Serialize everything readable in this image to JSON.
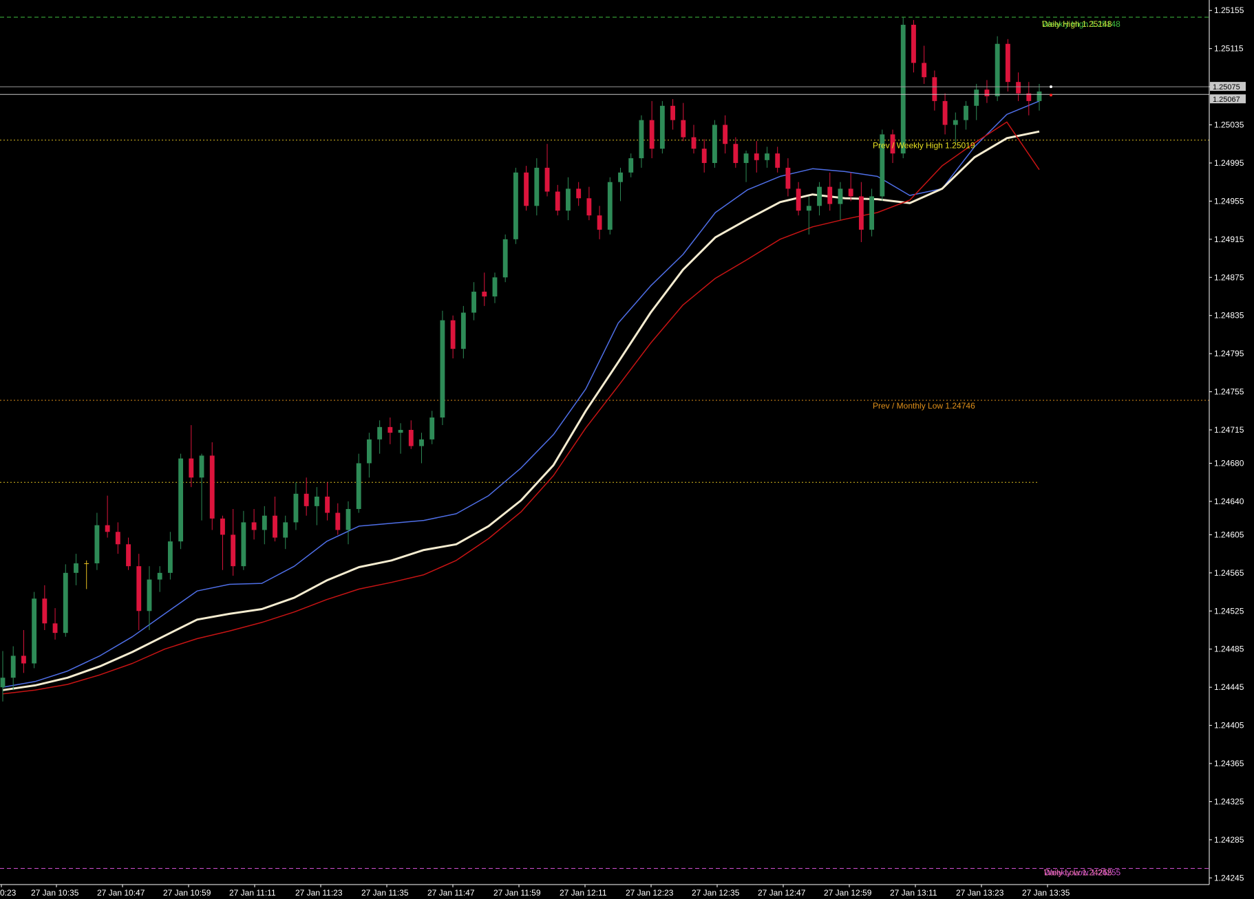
{
  "chart_data": {
    "type": "candlestick",
    "symbol_pair_note": "",
    "y_axis": {
      "ticks": [
        "1.25155",
        "1.25115",
        "1.25075",
        "1.25035",
        "1.24995",
        "1.24955",
        "1.24915",
        "1.24875",
        "1.24835",
        "1.24795",
        "1.24755",
        "1.24715",
        "1.24680",
        "1.24640",
        "1.24605",
        "1.24565",
        "1.24525",
        "1.24485",
        "1.24445",
        "1.24405",
        "1.24365",
        "1.24325",
        "1.24285",
        "1.24245"
      ],
      "ylim": [
        1.24238,
        1.25166
      ]
    },
    "x_axis": {
      "ticks": [
        "0:23",
        "27 Jan 10:35",
        "27 Jan 10:47",
        "27 Jan 10:59",
        "27 Jan 11:11",
        "27 Jan 11:23",
        "27 Jan 11:35",
        "27 Jan 11:47",
        "27 Jan 11:59",
        "27 Jan 12:11",
        "27 Jan 12:23",
        "27 Jan 12:35",
        "27 Jan 12:47",
        "27 Jan 12:59",
        "27 Jan 13:11",
        "27 Jan 13:23",
        "27 Jan 13:35"
      ]
    },
    "current_price": {
      "bid": "1.25067",
      "ask": "1.25075",
      "bid_value": 1.25067,
      "ask_value": 1.25075
    },
    "levels": [
      {
        "label": "Weekly High 1.25148",
        "value": 1.25148,
        "color": "#3fbf3f",
        "style": "dashed",
        "label_color": "#3fbf3f"
      },
      {
        "label": "Daily High 1.25148",
        "value": 1.25148,
        "color": "#3fbf3f",
        "style": "none",
        "label_color": "#c8e03a"
      },
      {
        "label": "Prev / Weekly High 1.25019",
        "value": 1.25019,
        "color": "#e0c020",
        "style": "dotted",
        "label_color": "#e8e020"
      },
      {
        "label": "Prev / Monthly Low 1.24746",
        "value": 1.24746,
        "color": "#e0901a",
        "style": "dotted",
        "label_color": "#e0901a"
      },
      {
        "label": "",
        "value": 1.2466,
        "color": "#e0c020",
        "style": "dotted",
        "label_color": "#e0c020"
      },
      {
        "label": "Weekly Low 1.24255",
        "value": 1.24255,
        "color": "#d050d0",
        "style": "dashed",
        "label_color": "#d050d0"
      },
      {
        "label": "Daily Low 1.24255",
        "value": 1.24255,
        "color": "#d050d0",
        "style": "none",
        "label_color": "#f070b0"
      }
    ],
    "moving_averages": [
      {
        "color": "#4f6fe8",
        "width": 1.5,
        "values": [
          1.24445,
          1.24451,
          1.24462,
          1.24478,
          1.24498,
          1.24522,
          1.24546,
          1.24553,
          1.24554,
          1.24572,
          1.24598,
          1.24614,
          1.24617,
          1.2462,
          1.24627,
          1.24646,
          1.24675,
          1.2471,
          1.24758,
          1.24827,
          1.24866,
          1.24899,
          1.24943,
          1.24967,
          1.24981,
          1.24989,
          1.24986,
          1.24981,
          1.24961,
          1.24968,
          1.25012,
          1.25046,
          1.2506
        ]
      },
      {
        "color": "#f5ecd0",
        "width": 3,
        "values": [
          1.24442,
          1.24447,
          1.24455,
          1.24467,
          1.24482,
          1.24499,
          1.24516,
          1.24522,
          1.24527,
          1.24539,
          1.24557,
          1.24571,
          1.24578,
          1.24589,
          1.24595,
          1.24614,
          1.24641,
          1.24678,
          1.24735,
          1.24786,
          1.24838,
          1.24883,
          1.24917,
          1.24936,
          1.24954,
          1.24962,
          1.24958,
          1.24957,
          1.24953,
          1.24968,
          1.25001,
          1.25021,
          1.25028
        ]
      },
      {
        "color": "#c81414",
        "width": 1.5,
        "values": [
          1.24438,
          1.24442,
          1.24448,
          1.24458,
          1.2447,
          1.24485,
          1.24496,
          1.24504,
          1.24513,
          1.24524,
          1.24537,
          1.24548,
          1.24555,
          1.24563,
          1.24578,
          1.24601,
          1.24629,
          1.24667,
          1.24717,
          1.24761,
          1.24806,
          1.24846,
          1.24874,
          1.24894,
          1.24915,
          1.24928,
          1.24936,
          1.24943,
          1.24956,
          1.24992,
          1.25016,
          1.25038,
          1.24988
        ]
      }
    ],
    "candle_colors": {
      "bull": "#2e8b57",
      "bear": "#dc143c",
      "doji": "#e8c020"
    },
    "candles": [
      {
        "o": 1.24445,
        "h": 1.24483,
        "l": 1.2443,
        "c": 1.24455
      },
      {
        "o": 1.24455,
        "h": 1.24488,
        "l": 1.24442,
        "c": 1.24478
      },
      {
        "o": 1.24478,
        "h": 1.24505,
        "l": 1.2446,
        "c": 1.2447
      },
      {
        "o": 1.2447,
        "h": 1.24545,
        "l": 1.24465,
        "c": 1.24538
      },
      {
        "o": 1.24538,
        "h": 1.24552,
        "l": 1.24505,
        "c": 1.24512
      },
      {
        "o": 1.24512,
        "h": 1.24528,
        "l": 1.24495,
        "c": 1.24502
      },
      {
        "o": 1.24502,
        "h": 1.24574,
        "l": 1.24498,
        "c": 1.24565
      },
      {
        "o": 1.24565,
        "h": 1.24585,
        "l": 1.24552,
        "c": 1.24575
      },
      {
        "o": 1.24575,
        "h": 1.24578,
        "l": 1.24548,
        "c": 1.24575
      },
      {
        "o": 1.24575,
        "h": 1.24628,
        "l": 1.24568,
        "c": 1.24615
      },
      {
        "o": 1.24615,
        "h": 1.24646,
        "l": 1.24602,
        "c": 1.24608
      },
      {
        "o": 1.24608,
        "h": 1.24618,
        "l": 1.24585,
        "c": 1.24595
      },
      {
        "o": 1.24595,
        "h": 1.24602,
        "l": 1.24568,
        "c": 1.24572
      },
      {
        "o": 1.24572,
        "h": 1.24585,
        "l": 1.24505,
        "c": 1.24525
      },
      {
        "o": 1.24525,
        "h": 1.24572,
        "l": 1.24505,
        "c": 1.24558
      },
      {
        "o": 1.24558,
        "h": 1.24572,
        "l": 1.24545,
        "c": 1.24565
      },
      {
        "o": 1.24565,
        "h": 1.24608,
        "l": 1.24558,
        "c": 1.24598
      },
      {
        "o": 1.24598,
        "h": 1.2469,
        "l": 1.2459,
        "c": 1.24685
      },
      {
        "o": 1.24685,
        "h": 1.2472,
        "l": 1.24655,
        "c": 1.24665
      },
      {
        "o": 1.24665,
        "h": 1.2469,
        "l": 1.2462,
        "c": 1.24688
      },
      {
        "o": 1.24688,
        "h": 1.24702,
        "l": 1.2461,
        "c": 1.24622
      },
      {
        "o": 1.24622,
        "h": 1.24625,
        "l": 1.24568,
        "c": 1.24605
      },
      {
        "o": 1.24605,
        "h": 1.24632,
        "l": 1.24562,
        "c": 1.24572
      },
      {
        "o": 1.24572,
        "h": 1.2463,
        "l": 1.24568,
        "c": 1.24618
      },
      {
        "o": 1.24618,
        "h": 1.24632,
        "l": 1.246,
        "c": 1.2461
      },
      {
        "o": 1.2461,
        "h": 1.24635,
        "l": 1.24595,
        "c": 1.24625
      },
      {
        "o": 1.24625,
        "h": 1.24645,
        "l": 1.24598,
        "c": 1.24602
      },
      {
        "o": 1.24602,
        "h": 1.24625,
        "l": 1.2459,
        "c": 1.24618
      },
      {
        "o": 1.24618,
        "h": 1.2466,
        "l": 1.2461,
        "c": 1.24648
      },
      {
        "o": 1.24648,
        "h": 1.24665,
        "l": 1.24625,
        "c": 1.24635
      },
      {
        "o": 1.24635,
        "h": 1.24655,
        "l": 1.24615,
        "c": 1.24645
      },
      {
        "o": 1.24645,
        "h": 1.2466,
        "l": 1.2462,
        "c": 1.24628
      },
      {
        "o": 1.24628,
        "h": 1.24638,
        "l": 1.24605,
        "c": 1.2461
      },
      {
        "o": 1.2461,
        "h": 1.2464,
        "l": 1.24595,
        "c": 1.24632
      },
      {
        "o": 1.24632,
        "h": 1.2469,
        "l": 1.24628,
        "c": 1.2468
      },
      {
        "o": 1.2468,
        "h": 1.24712,
        "l": 1.24665,
        "c": 1.24705
      },
      {
        "o": 1.24705,
        "h": 1.24725,
        "l": 1.2469,
        "c": 1.24718
      },
      {
        "o": 1.24718,
        "h": 1.24728,
        "l": 1.247,
        "c": 1.24712
      },
      {
        "o": 1.24712,
        "h": 1.24722,
        "l": 1.2469,
        "c": 1.24715
      },
      {
        "o": 1.24715,
        "h": 1.24725,
        "l": 1.24695,
        "c": 1.24698
      },
      {
        "o": 1.24698,
        "h": 1.24712,
        "l": 1.2468,
        "c": 1.24705
      },
      {
        "o": 1.24705,
        "h": 1.24735,
        "l": 1.247,
        "c": 1.24728
      },
      {
        "o": 1.24728,
        "h": 1.2484,
        "l": 1.2472,
        "c": 1.2483
      },
      {
        "o": 1.2483,
        "h": 1.24835,
        "l": 1.2479,
        "c": 1.248
      },
      {
        "o": 1.248,
        "h": 1.24845,
        "l": 1.2479,
        "c": 1.24838
      },
      {
        "o": 1.24838,
        "h": 1.2487,
        "l": 1.2483,
        "c": 1.2486
      },
      {
        "o": 1.2486,
        "h": 1.2488,
        "l": 1.24845,
        "c": 1.24855
      },
      {
        "o": 1.24855,
        "h": 1.2488,
        "l": 1.24848,
        "c": 1.24875
      },
      {
        "o": 1.24875,
        "h": 1.2492,
        "l": 1.2487,
        "c": 1.24915
      },
      {
        "o": 1.24915,
        "h": 1.2499,
        "l": 1.2491,
        "c": 1.24985
      },
      {
        "o": 1.24985,
        "h": 1.24992,
        "l": 1.24945,
        "c": 1.2495
      },
      {
        "o": 1.2495,
        "h": 1.25,
        "l": 1.2494,
        "c": 1.2499
      },
      {
        "o": 1.2499,
        "h": 1.25015,
        "l": 1.2496,
        "c": 1.24965
      },
      {
        "o": 1.24965,
        "h": 1.24972,
        "l": 1.2494,
        "c": 1.24945
      },
      {
        "o": 1.24945,
        "h": 1.2498,
        "l": 1.24935,
        "c": 1.24968
      },
      {
        "o": 1.24968,
        "h": 1.24975,
        "l": 1.2495,
        "c": 1.24958
      },
      {
        "o": 1.24958,
        "h": 1.2497,
        "l": 1.24935,
        "c": 1.2494
      },
      {
        "o": 1.2494,
        "h": 1.2495,
        "l": 1.24915,
        "c": 1.24925
      },
      {
        "o": 1.24925,
        "h": 1.2498,
        "l": 1.2492,
        "c": 1.24975
      },
      {
        "o": 1.24975,
        "h": 1.2499,
        "l": 1.24955,
        "c": 1.24985
      },
      {
        "o": 1.24985,
        "h": 1.25005,
        "l": 1.2498,
        "c": 1.25
      },
      {
        "o": 1.25,
        "h": 1.25045,
        "l": 1.2499,
        "c": 1.2504
      },
      {
        "o": 1.2504,
        "h": 1.2506,
        "l": 1.25,
        "c": 1.2501
      },
      {
        "o": 1.2501,
        "h": 1.2506,
        "l": 1.25005,
        "c": 1.25055
      },
      {
        "o": 1.25055,
        "h": 1.25062,
        "l": 1.2503,
        "c": 1.2504
      },
      {
        "o": 1.2504,
        "h": 1.25058,
        "l": 1.25018,
        "c": 1.25022
      },
      {
        "o": 1.25022,
        "h": 1.25035,
        "l": 1.25005,
        "c": 1.2501
      },
      {
        "o": 1.2501,
        "h": 1.2502,
        "l": 1.24985,
        "c": 1.24995
      },
      {
        "o": 1.24995,
        "h": 1.2504,
        "l": 1.2499,
        "c": 1.25035
      },
      {
        "o": 1.25035,
        "h": 1.25045,
        "l": 1.25005,
        "c": 1.25015
      },
      {
        "o": 1.25015,
        "h": 1.25022,
        "l": 1.2499,
        "c": 1.24995
      },
      {
        "o": 1.24995,
        "h": 1.25008,
        "l": 1.24975,
        "c": 1.25005
      },
      {
        "o": 1.25005,
        "h": 1.25018,
        "l": 1.24985,
        "c": 1.24998
      },
      {
        "o": 1.24998,
        "h": 1.25012,
        "l": 1.2499,
        "c": 1.25005
      },
      {
        "o": 1.25005,
        "h": 1.25012,
        "l": 1.24985,
        "c": 1.2499
      },
      {
        "o": 1.2499,
        "h": 1.25,
        "l": 1.2496,
        "c": 1.24968
      },
      {
        "o": 1.24968,
        "h": 1.24975,
        "l": 1.2494,
        "c": 1.24945
      },
      {
        "o": 1.24945,
        "h": 1.2496,
        "l": 1.2492,
        "c": 1.2495
      },
      {
        "o": 1.2495,
        "h": 1.24975,
        "l": 1.2494,
        "c": 1.2497
      },
      {
        "o": 1.2497,
        "h": 1.24985,
        "l": 1.24945,
        "c": 1.24952
      },
      {
        "o": 1.24952,
        "h": 1.24975,
        "l": 1.24935,
        "c": 1.24968
      },
      {
        "o": 1.24968,
        "h": 1.24985,
        "l": 1.24955,
        "c": 1.2496
      },
      {
        "o": 1.2496,
        "h": 1.24975,
        "l": 1.24912,
        "c": 1.24925
      },
      {
        "o": 1.24925,
        "h": 1.24968,
        "l": 1.24918,
        "c": 1.2496
      },
      {
        "o": 1.2496,
        "h": 1.2503,
        "l": 1.24955,
        "c": 1.25025
      },
      {
        "o": 1.25025,
        "h": 1.2503,
        "l": 1.24995,
        "c": 1.25005
      },
      {
        "o": 1.25005,
        "h": 1.25148,
        "l": 1.25,
        "c": 1.2514
      },
      {
        "o": 1.2514,
        "h": 1.25145,
        "l": 1.2509,
        "c": 1.251
      },
      {
        "o": 1.251,
        "h": 1.25118,
        "l": 1.25078,
        "c": 1.25085
      },
      {
        "o": 1.25085,
        "h": 1.25092,
        "l": 1.2505,
        "c": 1.2506
      },
      {
        "o": 1.2506,
        "h": 1.25068,
        "l": 1.25025,
        "c": 1.25035
      },
      {
        "o": 1.25035,
        "h": 1.25048,
        "l": 1.25015,
        "c": 1.2504
      },
      {
        "o": 1.2504,
        "h": 1.2506,
        "l": 1.2503,
        "c": 1.25055
      },
      {
        "o": 1.25055,
        "h": 1.25078,
        "l": 1.2504,
        "c": 1.25072
      },
      {
        "o": 1.25072,
        "h": 1.25082,
        "l": 1.25058,
        "c": 1.25065
      },
      {
        "o": 1.25065,
        "h": 1.25128,
        "l": 1.2506,
        "c": 1.2512
      },
      {
        "o": 1.2512,
        "h": 1.25125,
        "l": 1.2507,
        "c": 1.2508
      },
      {
        "o": 1.2508,
        "h": 1.2509,
        "l": 1.2506,
        "c": 1.25068
      },
      {
        "o": 1.25068,
        "h": 1.2508,
        "l": 1.25045,
        "c": 1.2506
      },
      {
        "o": 1.2506,
        "h": 1.25078,
        "l": 1.2505,
        "c": 1.2507
      }
    ]
  }
}
